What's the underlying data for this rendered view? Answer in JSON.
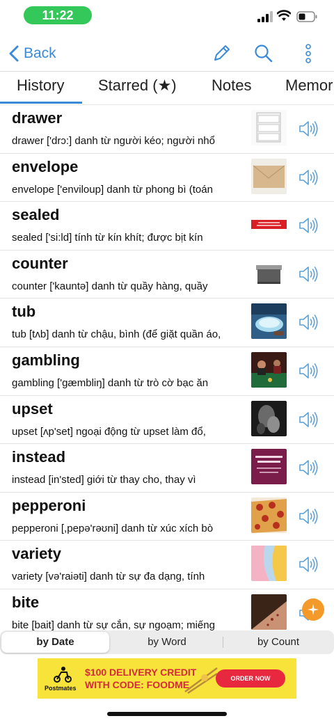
{
  "status_bar": {
    "time": "11:22"
  },
  "nav": {
    "back_label": "Back",
    "icons": [
      "pencil-icon",
      "search-icon",
      "more-vertical-icon",
      "chevron-left-icon"
    ]
  },
  "tabs": [
    {
      "label": "History",
      "active": true
    },
    {
      "label": "Starred (★)"
    },
    {
      "label": "Notes"
    },
    {
      "label": "Memor"
    }
  ],
  "entries": [
    {
      "word": "drawer",
      "definition": "drawer ['drɔ:] danh từ người kéo; người nhổ",
      "thumb": "drawer-image"
    },
    {
      "word": "envelope",
      "definition": "envelope ['enviloup] danh từ phong bì (toán",
      "thumb": "envelope-image"
    },
    {
      "word": "sealed",
      "definition": "sealed ['si:ld] tính từ kín khít; được bịt kín",
      "thumb": "sealed-image"
    },
    {
      "word": "counter",
      "definition": "counter ['kauntə] danh từ quầy hàng, quầy",
      "thumb": "counter-image"
    },
    {
      "word": "tub",
      "definition": "tub [tʌb] danh từ chậu, bình (để giặt quần áo,",
      "thumb": "tub-image"
    },
    {
      "word": "gambling",
      "definition": "gambling ['gæmbliŋ] danh từ trò cờ bạc ăn",
      "thumb": "gambling-image"
    },
    {
      "word": "upset",
      "definition": "upset [ʌp'set] ngoại động từ upset làm đổ,",
      "thumb": "upset-image"
    },
    {
      "word": "instead",
      "definition": "instead [in'sted] giới từ thay cho, thay vì",
      "thumb": "instead-image"
    },
    {
      "word": "pepperoni",
      "definition": "pepperoni [,pepə'rəʊni] danh từ xúc xích bò",
      "thumb": "pepperoni-image"
    },
    {
      "word": "variety",
      "definition": "variety [və'raiəti] danh từ sự đa dạng, tính",
      "thumb": "variety-image"
    },
    {
      "word": "bite",
      "definition": "bite [bait] danh từ sự cắn, sự ngoạm; miếng",
      "thumb": "bite-image"
    }
  ],
  "sort": {
    "options": [
      "by Date",
      "by Word",
      "by Count"
    ],
    "selected": "by Date"
  },
  "ad": {
    "brand": "Postmates",
    "headline_1": "$100 DELIVERY CREDIT",
    "headline_2": "WITH CODE: FOODME",
    "cta": "ORDER NOW"
  },
  "colors": {
    "accent": "#3b8ad8",
    "status_pill": "#34c759",
    "ad_bg": "#f8e33a",
    "ad_cta": "#e8283f",
    "fab": "#f39a2a"
  }
}
